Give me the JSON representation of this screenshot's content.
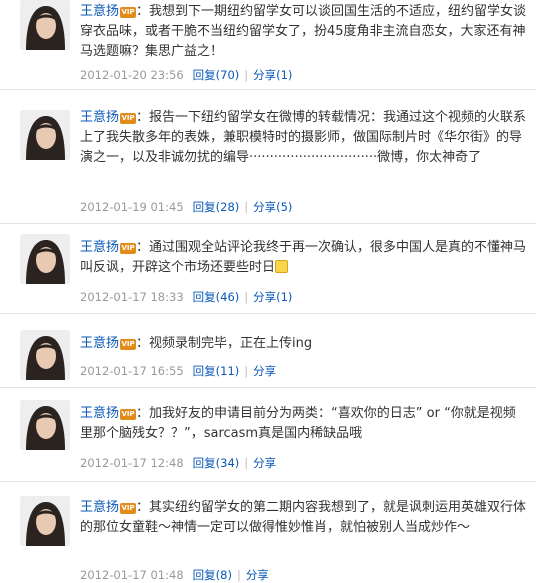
{
  "posts": [
    {
      "author": "王意扬",
      "vip": "VIP",
      "colon": "：",
      "text": "我想到下一期纽约留学女可以谈回国生活的不适应，纽约留学女谈穿衣品味，或者干脆不当纽约留学女了，扮45度角非主流自恋女，大家还有神马选题嘛？集思广益之！",
      "time": "2012-01-20 23:56",
      "reply": "回复(70)",
      "share": "分享(1)"
    },
    {
      "author": "王意扬",
      "vip": "VIP",
      "colon": "：",
      "text": "报告一下纽约留学女在微博的转载情况：我通过这个视频的火联系上了我失散多年的表姝，兼职模特时的摄影师，做国际制片时《华尔街》的导演之一，以及非诚勿扰的编导·······························微博，你太神奇了",
      "time": "2012-01-19 01:45",
      "reply": "回复(28)",
      "share": "分享(5)"
    },
    {
      "author": "王意扬",
      "vip": "VIP",
      "colon": "：",
      "text": "通过围观全站评论我终于再一次确认，很多中国人是真的不懂神马叫反讽，开辟这个市场还要些时日",
      "time": "2012-01-17 18:33",
      "reply": "回复(46)",
      "share": "分享(1)"
    },
    {
      "author": "王意扬",
      "vip": "VIP",
      "colon": "：",
      "text": "视频录制完毕，正在上传ing",
      "time": "2012-01-17 16:55",
      "reply": "回复(11)",
      "share": "分享"
    },
    {
      "author": "王意扬",
      "vip": "VIP",
      "colon": "：",
      "text": "加我好友的申请目前分为两类：“喜欢你的日志” or “你就是视频里那个脑残女？？”，sarcasm真是国内稀缺品哦",
      "time": "2012-01-17 12:48",
      "reply": "回复(34)",
      "share": "分享"
    },
    {
      "author": "王意扬",
      "vip": "VIP",
      "colon": "：",
      "text": "其实纽约留学女的第二期内容我想到了，就是讽刺运用英雄双行体的那位女童鞋～神情一定可以做得惟妙惟肖，就怕被别人当成炒作～",
      "time": "2012-01-17 01:48",
      "reply": "回复(8)",
      "share": "分享"
    }
  ],
  "colors": {
    "link": "#0a58b7",
    "text": "#333333",
    "time": "#999999",
    "divider": "#e3e3e3"
  },
  "icons": [
    "avatar-photo",
    "vip-badge-icon",
    "emoji-icon"
  ]
}
